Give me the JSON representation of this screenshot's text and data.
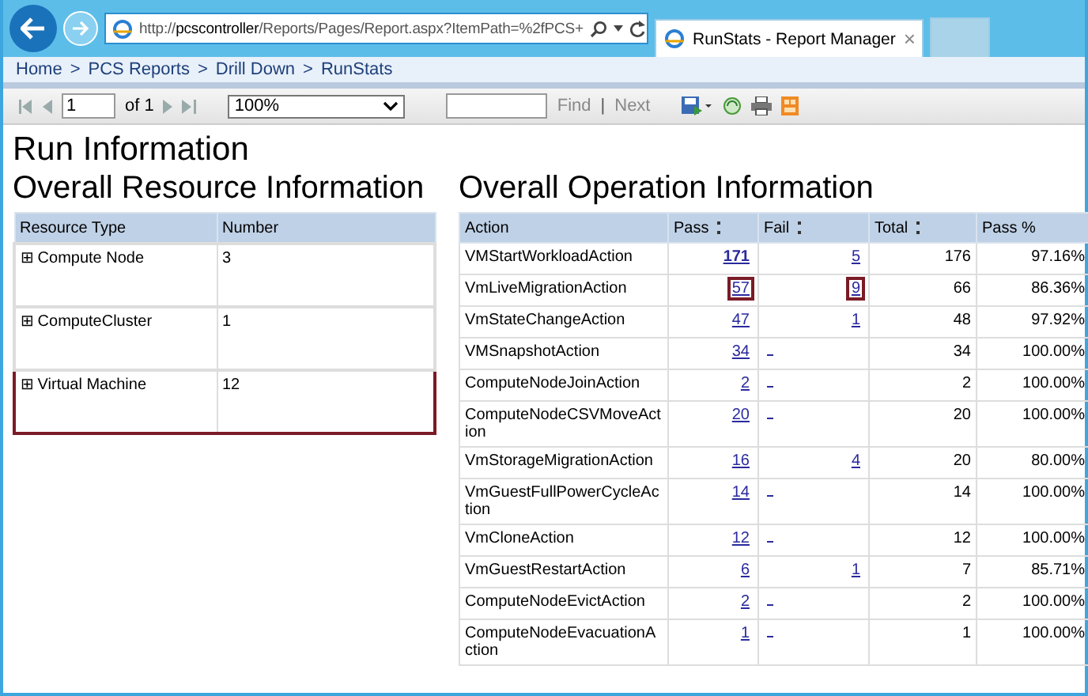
{
  "browser": {
    "address_scheme": "http://",
    "address_host": "pcscontroller",
    "address_path": "/Reports/Pages/Report.aspx?ItemPath=%2fPCS+",
    "tab": {
      "title": "RunStats - Report Manager",
      "close": "×",
      "selected": true
    }
  },
  "breadcrumb": {
    "separator": ">",
    "items": [
      "Home",
      "PCS Reports",
      "Drill Down",
      "RunStats"
    ]
  },
  "toolbar": {
    "page": "1",
    "of": "of 1",
    "zoom": "100%",
    "find": "Find",
    "divider": "|",
    "next": "Next"
  },
  "report": {
    "title": "Run Information",
    "resources": {
      "title": "Overall Resource Information",
      "columns": [
        "Resource Type",
        "Number"
      ],
      "rows": [
        {
          "expander": "⊞",
          "type": "Compute Node",
          "number": "3",
          "highlighted": false
        },
        {
          "expander": "⊞",
          "type": "ComputeCluster",
          "number": "1",
          "highlighted": false
        },
        {
          "expander": "⊞",
          "type": "Virtual Machine",
          "number": "12",
          "highlighted": true
        }
      ]
    },
    "operations": {
      "title": "Overall Operation Information",
      "columns": [
        {
          "label": "Action",
          "sortable": false
        },
        {
          "label": "Pass",
          "sortable": true
        },
        {
          "label": "Fail",
          "sortable": true
        },
        {
          "label": "Total",
          "sortable": true
        },
        {
          "label": "Pass %",
          "sortable": false
        }
      ],
      "rows": [
        {
          "action": "VMStartWorkloadAction",
          "pass": "171",
          "fail": "5",
          "total": "176",
          "pass_pct": "97.16%",
          "pass_highlighted": false,
          "fail_highlighted": false
        },
        {
          "action": "VmLiveMigrationAction",
          "pass": "57",
          "fail": "9",
          "total": "66",
          "pass_pct": "86.36%",
          "pass_highlighted": true,
          "fail_highlighted": true
        },
        {
          "action": "VmStateChangeAction",
          "pass": "47",
          "fail": "1",
          "total": "48",
          "pass_pct": "97.92%",
          "pass_highlighted": false,
          "fail_highlighted": false
        },
        {
          "action": "VMSnapshotAction",
          "pass": "34",
          "total": "34",
          "pass_pct": "100.00%",
          "pass_highlighted": false,
          "fail_highlighted": false
        },
        {
          "action": "ComputeNodeJoinAction",
          "pass": "2",
          "total": "2",
          "pass_pct": "100.00%",
          "pass_highlighted": false,
          "fail_highlighted": false
        },
        {
          "action": "ComputeNodeCSVMoveAction",
          "pass": "20",
          "total": "20",
          "pass_pct": "100.00%",
          "pass_highlighted": false,
          "fail_highlighted": false
        },
        {
          "action": "VmStorageMigrationAction",
          "pass": "16",
          "fail": "4",
          "total": "20",
          "pass_pct": "80.00%",
          "pass_highlighted": false,
          "fail_highlighted": false
        },
        {
          "action": "VmGuestFullPowerCycleAction",
          "pass": "14",
          "total": "14",
          "pass_pct": "100.00%",
          "pass_highlighted": false,
          "fail_highlighted": false
        },
        {
          "action": "VmCloneAction",
          "pass": "12",
          "total": "12",
          "pass_pct": "100.00%",
          "pass_highlighted": false,
          "fail_highlighted": false
        },
        {
          "action": "VmGuestRestartAction",
          "pass": "6",
          "fail": "1",
          "total": "7",
          "pass_pct": "85.71%",
          "pass_highlighted": false,
          "fail_highlighted": false
        },
        {
          "action": "ComputeNodeEvictAction",
          "pass": "2",
          "total": "2",
          "pass_pct": "100.00%",
          "pass_highlighted": false,
          "fail_highlighted": false
        },
        {
          "action": "ComputeNodeEvacuationAction",
          "pass": "1",
          "total": "1",
          "pass_pct": "100.00%",
          "pass_highlighted": false,
          "fail_highlighted": false
        }
      ]
    }
  }
}
